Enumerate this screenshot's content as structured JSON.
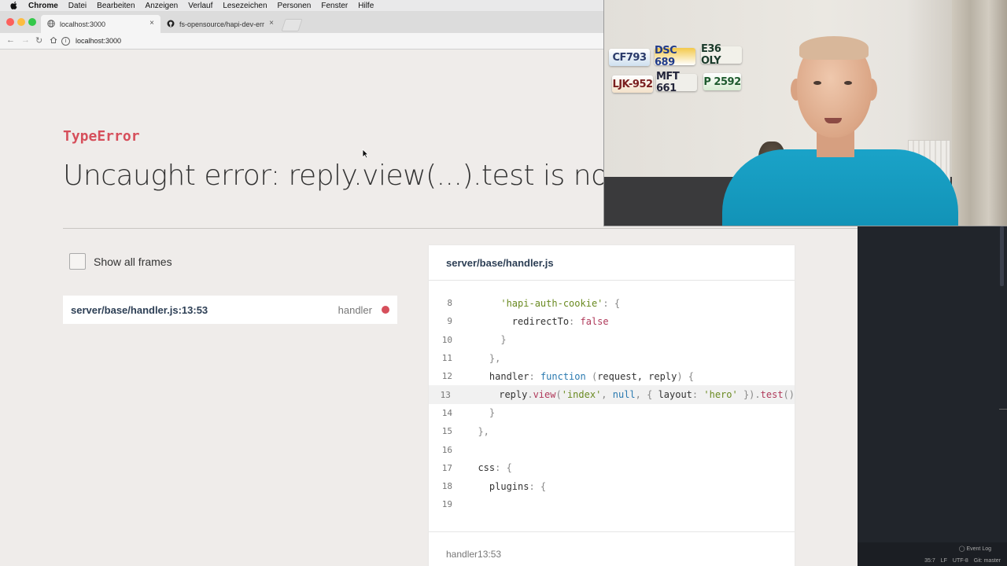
{
  "menubar": {
    "items": [
      "Chrome",
      "Datei",
      "Bearbeiten",
      "Anzeigen",
      "Verlauf",
      "Lesezeichen",
      "Personen",
      "Fenster",
      "Hilfe"
    ]
  },
  "browser": {
    "tabs": [
      {
        "title": "localhost:3000",
        "icon": "globe-icon"
      },
      {
        "title": "fs-opensource/hapi-dev-error",
        "icon": "github-icon"
      }
    ],
    "url": "localhost:3000"
  },
  "error": {
    "type": "TypeError",
    "message": "Uncaught error: reply.view(...).test is not a fu"
  },
  "frames": {
    "show_all_label": "Show all frames",
    "items": [
      {
        "file": "server/base/handler.js:13:53",
        "function": "handler"
      }
    ]
  },
  "code_panel": {
    "file": "server/base/handler.js",
    "highlighted_line": "13",
    "footer": "handler13:53",
    "lines": [
      {
        "num": "8"
      },
      {
        "num": "9"
      },
      {
        "num": "10"
      },
      {
        "num": "11"
      },
      {
        "num": "12"
      },
      {
        "num": "13"
      },
      {
        "num": "14"
      },
      {
        "num": "15"
      },
      {
        "num": "16"
      },
      {
        "num": "17"
      },
      {
        "num": "18"
      },
      {
        "num": "19"
      }
    ],
    "tokens": {
      "l8_a": "'hapi-auth-cookie'",
      "l8_b": ": {",
      "l9_a": "redirectTo",
      "l9_b": ": ",
      "l9_c": "false",
      "l10_a": "}",
      "l11_a": "},",
      "l12_a": "handler",
      "l12_b": ": ",
      "l12_c": "function",
      "l12_d": " (",
      "l12_e": "request, reply",
      "l12_f": ") {",
      "l13_a": "reply",
      "l13_b": ".",
      "l13_c": "view",
      "l13_d": "(",
      "l13_e": "'index'",
      "l13_f": ", ",
      "l13_g": "null",
      "l13_h": ", { ",
      "l13_i": "layout",
      "l13_j": ": ",
      "l13_k": "'hero'",
      "l13_l": " }).",
      "l13_m": "test",
      "l13_n": "()",
      "l14_a": "}",
      "l15_a": "},",
      "l17_a": "css",
      "l17_b": ": {",
      "l18_a": "plugins",
      "l18_b": ": {"
    }
  },
  "editor_status": {
    "event_log": "Event Log",
    "position": "35:7",
    "line_ending": "LF",
    "encoding": "UTF-8",
    "git": "Git: master"
  },
  "webcam": {
    "plates": [
      "CF793",
      "DSC 689",
      "E36 OLY",
      "LJK-952",
      "MFT 661",
      "P 2592"
    ]
  },
  "colors": {
    "error_red": "#d64f5b",
    "file_blue": "#2d3f55",
    "page_bg": "#efecea",
    "editor_dark": "#21252b"
  }
}
